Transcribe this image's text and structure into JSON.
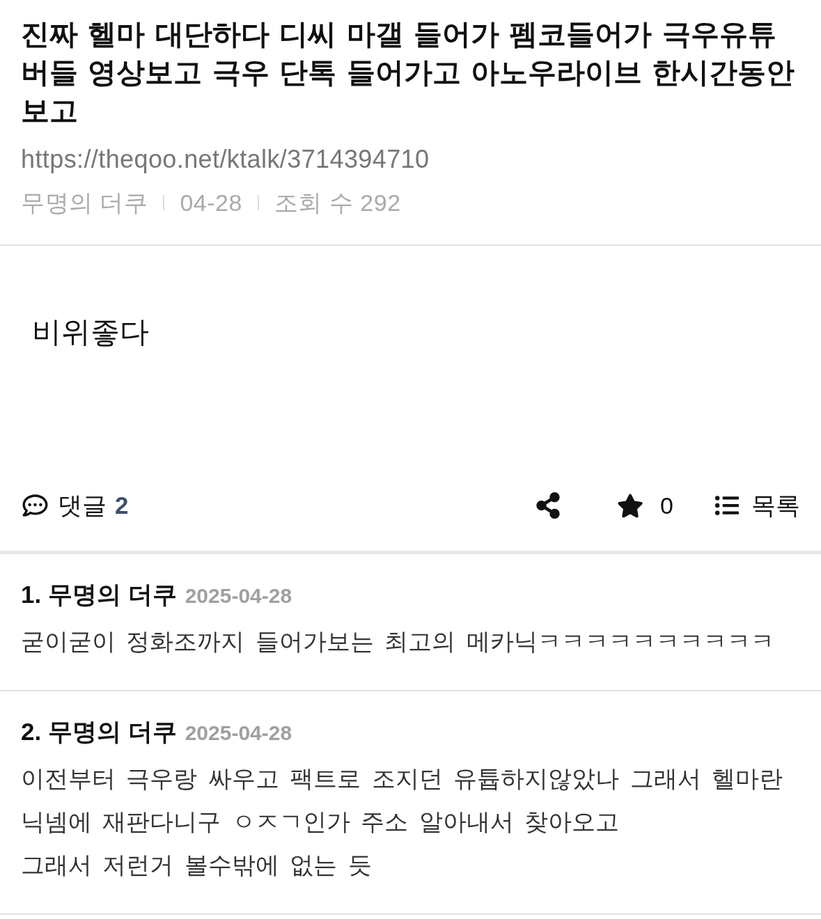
{
  "post": {
    "title": "진짜 헬마 대단하다 디씨 마갤 들어가 펨코들어가 극우유튜버들 영상보고 극우 단톡 들어가고 아노우라이브 한시간동안 보고",
    "url": "https://theqoo.net/ktalk/3714394710",
    "meta": [
      "무명의 더쿠",
      "04-28",
      "조회 수 292"
    ],
    "body": "비위좋다"
  },
  "toolbar": {
    "comments_label": "댓글",
    "comments_count": "2",
    "star_count": "0",
    "list_label": "목록"
  },
  "comments": [
    {
      "number": "1.",
      "author": "무명의 더쿠",
      "date": "2025-04-28",
      "text": "굳이굳이 정화조까지 들어가보는 최고의 메카닉ㅋㅋㅋㅋㅋㅋㅋㅋㅋㅋ"
    },
    {
      "number": "2.",
      "author": "무명의 더쿠",
      "date": "2025-04-28",
      "text": "이전부터 극우랑 싸우고 팩트로 조지던 유튭하지않았나 그래서 헬마란 닉넴에 재판다니구 ㅇㅈㄱ인가 주소 알아내서 찾아오고\n그래서 저런거 볼수밖에 없는 듯"
    }
  ]
}
